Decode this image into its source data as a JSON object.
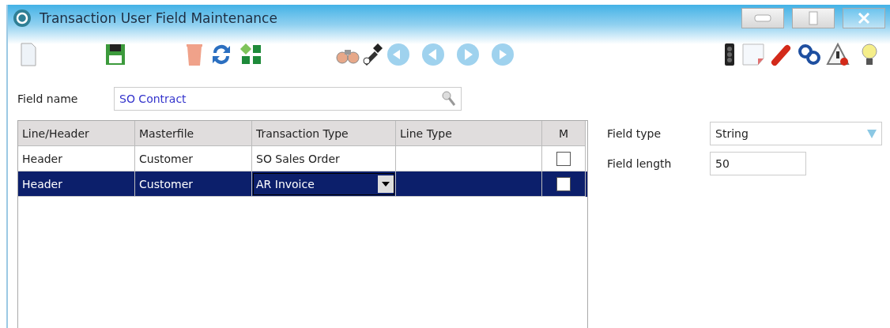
{
  "window": {
    "title": "Transaction User Field Maintenance"
  },
  "field_name": {
    "label": "Field name",
    "value": "SO Contract"
  },
  "table": {
    "columns": [
      "Line/Header",
      "Masterfile",
      "Transaction Type",
      "Line Type",
      "M"
    ],
    "rows": [
      {
        "line_header": "Header",
        "masterfile": "Customer",
        "transaction_type": "SO Sales Order",
        "editing": false,
        "line_type": "",
        "m_checked": false,
        "selected": false
      },
      {
        "line_header": "Header",
        "masterfile": "Customer",
        "transaction_type": "AR Invoice",
        "editing": true,
        "line_type": "",
        "m_checked": false,
        "selected": true
      }
    ]
  },
  "field_type": {
    "label": "Field type",
    "value": "String"
  },
  "field_length": {
    "label": "Field length",
    "value": "50"
  }
}
